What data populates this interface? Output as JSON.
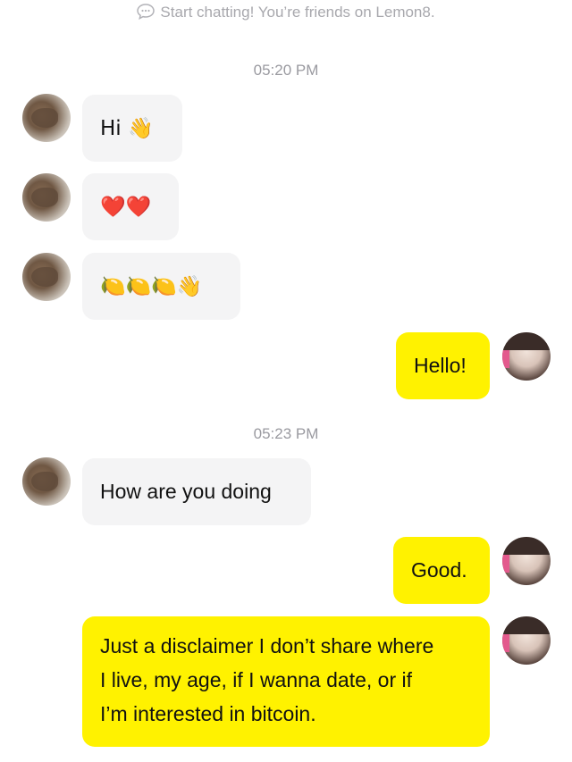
{
  "notice": {
    "icon": "chat-bubble-icon",
    "text": "Start chatting! You’re friends on Lemon8."
  },
  "timestamps": [
    "05:20 PM",
    "05:23 PM"
  ],
  "colors": {
    "outgoing_bubble": "#fff200",
    "incoming_bubble": "#f4f4f5"
  },
  "messages": [
    {
      "direction": "incoming",
      "text": "Hi 👋"
    },
    {
      "direction": "incoming",
      "text": "❤️❤️"
    },
    {
      "direction": "incoming",
      "text": "🍋🍋🍋👋"
    },
    {
      "direction": "outgoing",
      "text": "Hello!"
    },
    {
      "direction": "incoming",
      "text": "How are you doing"
    },
    {
      "direction": "outgoing",
      "text": "Good."
    },
    {
      "direction": "outgoing",
      "lines": [
        "Just a disclaimer I don’t share where",
        "I live, my age, if I wanna date, or if",
        "I’m interested in bitcoin."
      ]
    }
  ]
}
